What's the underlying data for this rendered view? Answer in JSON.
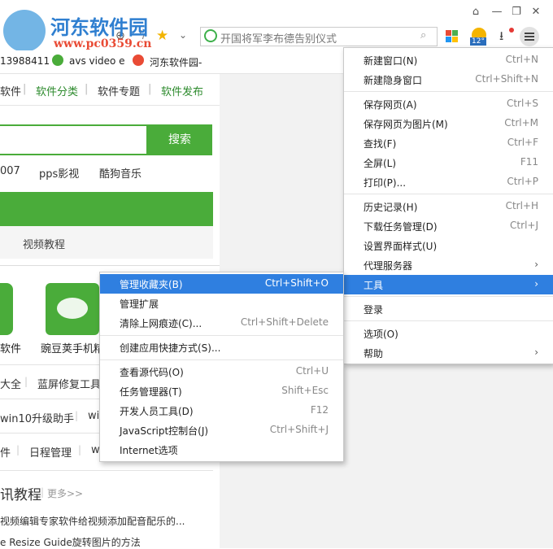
{
  "watermark": {
    "site_name": "河东软件园",
    "url": "www.pc0359.cn"
  },
  "toolbar": {
    "search_placeholder": "开国将军李布德告别仪式",
    "weather_temp": "12°"
  },
  "bookmarks": [
    "13988411",
    "avs video e",
    "河东软件园-"
  ],
  "nav": [
    "软件",
    "软件分类",
    "软件专题",
    "软件发布"
  ],
  "search": {
    "button": "搜索"
  },
  "hot_terms": [
    "007",
    "pps影视",
    "酷狗音乐"
  ],
  "video_tutorial": "视频教程",
  "apps": [
    "软件",
    "豌豆荚手机精"
  ],
  "tags_row1": [
    "大全",
    "蓝屏修复工具"
  ],
  "tags_row2": [
    "win10升级助手",
    "wi"
  ],
  "tags_row3": [
    "件",
    "日程管理",
    "w"
  ],
  "news": {
    "title": "讯教程",
    "more": "更多>>",
    "items": [
      "视频编辑专家软件给视频添加配音配乐的...",
      "e Resize Guide旋转图片的方法"
    ]
  },
  "main_menu": {
    "group1": [
      {
        "label": "新建窗口(N)",
        "shortcut": "Ctrl+N"
      },
      {
        "label": "新建隐身窗口",
        "shortcut": "Ctrl+Shift+N"
      }
    ],
    "group2": [
      {
        "label": "保存网页(A)",
        "shortcut": "Ctrl+S"
      },
      {
        "label": "保存网页为图片(M)",
        "shortcut": "Ctrl+M"
      },
      {
        "label": "查找(F)",
        "shortcut": "Ctrl+F"
      },
      {
        "label": "全屏(L)",
        "shortcut": "F11"
      },
      {
        "label": "打印(P)...",
        "shortcut": "Ctrl+P"
      }
    ],
    "group3": [
      {
        "label": "历史记录(H)",
        "shortcut": "Ctrl+H"
      },
      {
        "label": "下载任务管理(D)",
        "shortcut": "Ctrl+J"
      },
      {
        "label": "设置界面样式(U)",
        "shortcut": ""
      },
      {
        "label": "代理服务器",
        "shortcut": ""
      },
      {
        "label": "工具",
        "shortcut": ""
      }
    ],
    "group4": [
      {
        "label": "登录",
        "shortcut": ""
      }
    ],
    "group5": [
      {
        "label": "选项(O)",
        "shortcut": ""
      },
      {
        "label": "帮助",
        "shortcut": ""
      }
    ]
  },
  "tools_menu": {
    "group1": [
      {
        "label": "管理收藏夹(B)",
        "shortcut": "Ctrl+Shift+O"
      },
      {
        "label": "管理扩展",
        "shortcut": ""
      },
      {
        "label": "清除上网痕迹(C)...",
        "shortcut": "Ctrl+Shift+Delete"
      }
    ],
    "group2": [
      {
        "label": "创建应用快捷方式(S)...",
        "shortcut": ""
      }
    ],
    "group3": [
      {
        "label": "查看源代码(O)",
        "shortcut": "Ctrl+U"
      },
      {
        "label": "任务管理器(T)",
        "shortcut": "Shift+Esc"
      },
      {
        "label": "开发人员工具(D)",
        "shortcut": "F12"
      },
      {
        "label": "JavaScript控制台(J)",
        "shortcut": "Ctrl+Shift+J"
      },
      {
        "label": "Internet选项",
        "shortcut": ""
      }
    ]
  },
  "colors": {
    "accent_green": "#4aac3a",
    "menu_highlight": "#2f7fe0"
  }
}
